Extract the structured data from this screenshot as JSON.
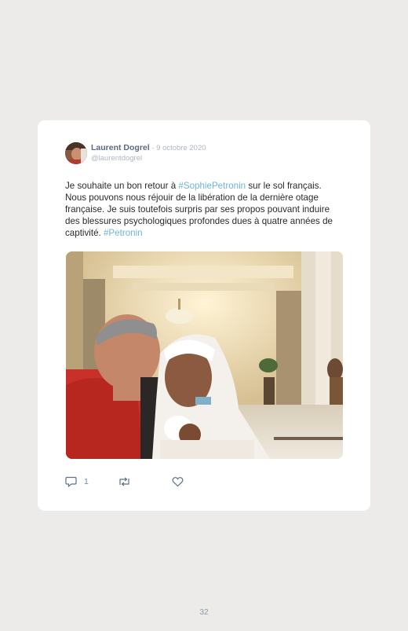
{
  "tweet": {
    "author_name": "Laurent Dogrel",
    "separator": " - ",
    "date": "9 octobre 2020",
    "handle": "@laurentdogrel",
    "text": {
      "part1": "Je souhaite un bon retour à ",
      "hashtag1": "#SophiePetronin",
      "part2": " sur le sol français. Nous pouvons nous réjouir de la libération de la dernière otage française. Je suis toutefois surpris par ses propos pouvant induire des blessures psychologiques profondes dues à quatre années de captivité. ",
      "hashtag2": "#Petronin"
    },
    "reply_count": "1",
    "icons": {
      "reply": "reply-bubble-icon",
      "retweet": "retweet-icon",
      "like": "heart-icon"
    },
    "colors": {
      "hashtag": "#6eb4de",
      "author": "#5a6a85",
      "muted": "#b0b7c2"
    }
  },
  "page": {
    "number": "32"
  }
}
